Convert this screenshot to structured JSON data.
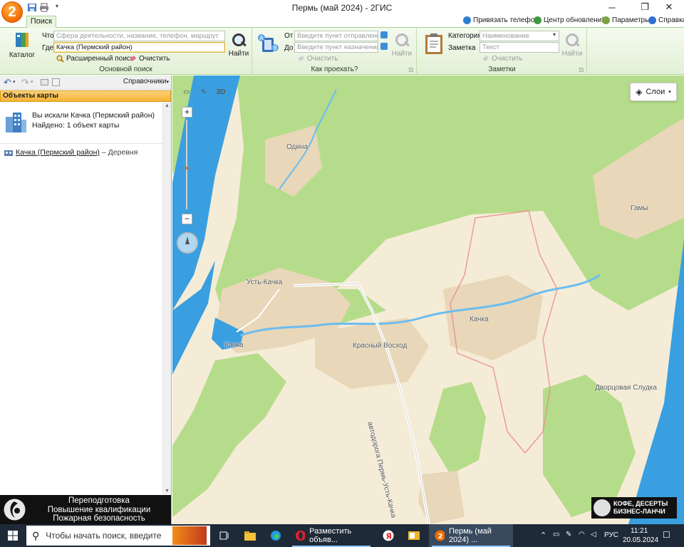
{
  "window": {
    "title": "Пермь (май 2024) - 2ГИС",
    "logo": "2",
    "controls": [
      "minimize",
      "maximize",
      "close"
    ]
  },
  "tabs": [
    {
      "label": "Поиск",
      "active": true
    }
  ],
  "top_links": {
    "attach_phone": "Привязать телефон",
    "update_center": "Центр обновлений",
    "settings": "Параметры",
    "help": "Справка"
  },
  "ribbon": {
    "main_search": {
      "catalog_label": "Каталог",
      "what_label": "Что",
      "what_placeholder": "Сфера деятельности, название, телефон, маршрут",
      "where_label": "Где",
      "where_value": "Качка (Пермский район)",
      "find_label": "Найти",
      "advanced_label": "Расширенный поиск",
      "clear_label": "Очистить",
      "caption": "Основной поиск"
    },
    "route": {
      "from_label": "От",
      "from_placeholder": "Введите пункт отправления",
      "to_label": "До",
      "to_placeholder": "Введите пункт назначения",
      "find_label": "Найти",
      "clear_label": "Очистить",
      "caption": "Как проехать?"
    },
    "notes": {
      "category_label": "Категория",
      "category_placeholder": "Наименование",
      "note_label": "Заметка",
      "note_placeholder": "Текст",
      "find_label": "Найти",
      "clear_label": "Очистить",
      "caption": "Заметки"
    }
  },
  "left_panel": {
    "toolbar_dropdown": "Справочники",
    "header": "Объекты карты",
    "summary_title": "Вы искали Качка (Пермский район)",
    "summary_found": "Найдено: 1 объект карты",
    "result_name": "Качка (Пермский район)",
    "result_type": "– Деревня",
    "ad_lines": [
      "Переподготовка",
      "Повышение квалификации",
      "Пожарная безопасность"
    ]
  },
  "map": {
    "mode_3d": "3D",
    "layers_label": "Слои",
    "labels": {
      "odina": "Одина",
      "gamy": "Гамы",
      "ust_kachka": "Усть-Качка",
      "kachka_river": "Качка",
      "kachka_village": "Качка",
      "krasny_voskhod": "Красный Восход",
      "dvortsovaya_sludka": "Дворцовая Слудка",
      "road": "автодорога Пермь-Усть-Качка"
    },
    "ad_lines": [
      "КОФЕ, ДЕСЕРТЫ",
      "БИЗНЕС-ЛАНЧИ"
    ],
    "colors": {
      "water": "#3a9fe0",
      "forest": "#b5dc8a",
      "land": "#f5ecd7",
      "settlement": "#e8d7b8",
      "boundary": "#e78a8a"
    }
  },
  "taskbar": {
    "search_placeholder": "Чтобы начать поиск, введите",
    "apps": [
      {
        "name": "task-view-icon"
      },
      {
        "name": "file-explorer-icon"
      },
      {
        "name": "edge-icon"
      },
      {
        "name": "opera-icon",
        "label": "Разместить объяв..."
      },
      {
        "name": "yandex-icon"
      },
      {
        "name": "outlook-icon"
      },
      {
        "name": "2gis-icon",
        "label": "Пермь (май 2024) ..."
      }
    ],
    "lang": "РУС",
    "time": "11:21",
    "date": "20.05.2024"
  }
}
